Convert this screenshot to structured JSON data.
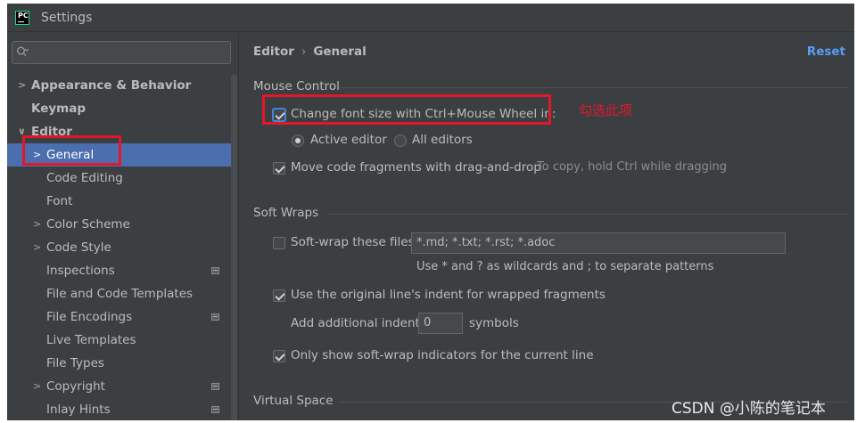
{
  "window": {
    "title": "Settings",
    "app_icon_text": "PC"
  },
  "search": {
    "placeholder": ""
  },
  "sidebar": {
    "items": [
      {
        "label": "Appearance & Behavior",
        "arrow": ">"
      },
      {
        "label": "Keymap",
        "arrow": ""
      },
      {
        "label": "Editor",
        "arrow": "∨"
      },
      {
        "label": "General",
        "arrow": ">"
      },
      {
        "label": "Code Editing",
        "arrow": ""
      },
      {
        "label": "Font",
        "arrow": ""
      },
      {
        "label": "Color Scheme",
        "arrow": ">"
      },
      {
        "label": "Code Style",
        "arrow": ">"
      },
      {
        "label": "Inspections",
        "arrow": ""
      },
      {
        "label": "File and Code Templates",
        "arrow": ""
      },
      {
        "label": "File Encodings",
        "arrow": ""
      },
      {
        "label": "Live Templates",
        "arrow": ""
      },
      {
        "label": "File Types",
        "arrow": ""
      },
      {
        "label": "Copyright",
        "arrow": ">"
      },
      {
        "label": "Inlay Hints",
        "arrow": ""
      }
    ]
  },
  "breadcrumb": {
    "parent": "Editor",
    "separator": "›",
    "current": "General"
  },
  "reset_label": "Reset",
  "mouse_control": {
    "title": "Mouse Control",
    "change_font_label": "Change font size with Ctrl+Mouse Wheel in:",
    "change_font_checked": true,
    "active_editor_label": "Active editor",
    "all_editors_label": "All editors",
    "selected_scope": "Active editor",
    "drag_drop_label": "Move code fragments with drag-and-drop",
    "drag_drop_checked": true,
    "drag_drop_hint": "To copy, hold Ctrl while dragging"
  },
  "soft_wraps": {
    "title": "Soft Wraps",
    "soft_wrap_label": "Soft-wrap these files:",
    "soft_wrap_checked": false,
    "soft_wrap_value": "*.md; *.txt; *.rst; *.adoc",
    "soft_wrap_hint": "Use * and ? as wildcards and ; to separate patterns",
    "indent_label": "Use the original line's indent for wrapped fragments",
    "indent_checked": true,
    "additional_indent_label": "Add additional indent:",
    "additional_indent_value": "0",
    "symbols_label": "symbols",
    "indicators_label": "Only show soft-wrap indicators for the current line",
    "indicators_checked": true
  },
  "virtual_space": {
    "title": "Virtual Space"
  },
  "annotation": {
    "text": "勾选此项",
    "color": "#e5162a"
  },
  "watermark": "CSDN @小陈的笔记本",
  "colors": {
    "accent": "#4b6eaf",
    "link": "#589df6",
    "background": "#3c3f41"
  }
}
